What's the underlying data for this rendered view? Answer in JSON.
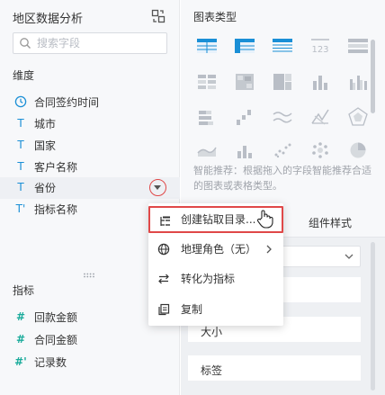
{
  "left_panel": {
    "title": "地区数据分析",
    "search_placeholder": "搜索字段",
    "dimension_title": "维度",
    "dimensions": [
      {
        "label": "合同签约时间",
        "icon": "clock-icon"
      },
      {
        "label": "城市",
        "icon": "text-type-icon",
        "glyph": "T"
      },
      {
        "label": "国家",
        "icon": "text-type-icon",
        "glyph": "T"
      },
      {
        "label": "客户名称",
        "icon": "text-type-icon",
        "glyph": "T"
      },
      {
        "label": "省份",
        "icon": "text-type-icon",
        "glyph": "T"
      },
      {
        "label": "指标名称",
        "icon": "text-type-calc-icon",
        "glyph": "T'"
      }
    ],
    "measure_title": "指标",
    "measures": [
      {
        "label": "回款金额",
        "icon": "number-type-icon",
        "glyph": "#"
      },
      {
        "label": "合同金额",
        "icon": "number-type-icon",
        "glyph": "#"
      },
      {
        "label": "记录数",
        "icon": "number-type-calc-icon",
        "glyph": "#'"
      }
    ]
  },
  "right_panel": {
    "chart_type_title": "图表类型",
    "chart_types": [
      "table-chart-icon",
      "crosstab-chart-icon",
      "detail-table-chart-icon",
      "kpi-chart-icon",
      "grouped-table-chart-icon",
      "color-table-chart-icon",
      "heatmap-chart-icon",
      "treemap-chart-icon",
      "bar-chart-icon",
      "grouped-bar-chart-icon",
      "stacked-bar-chart-icon",
      "waterfall-chart-icon",
      "line-chart-icon",
      "radar-chart-icon",
      "funnel-chart-icon",
      "area-chart-icon",
      "combo-chart-icon",
      "scatter-chart-icon",
      "bubble-chart-icon",
      "pie-chart-icon"
    ],
    "kpi_glyph": "123",
    "smart_tip": "智能推荐：根据拖入的字段智能推荐合适的图表或表格类型。",
    "component_style_tab": "组件样式",
    "properties": [
      "大小",
      "标签"
    ]
  },
  "context_menu": {
    "items": [
      {
        "label": "创建钻取目录...",
        "icon": "drill-tree-icon",
        "active": true
      },
      {
        "label": "地理角色（无）",
        "icon": "globe-icon",
        "has_submenu": true
      },
      {
        "label": "转化为指标",
        "icon": "swap-arrows-icon"
      },
      {
        "label": "复制",
        "icon": "copy-icon"
      }
    ]
  },
  "colors": {
    "accent_blue": "#1a8fd6",
    "accent_teal": "#1aab9b",
    "highlight_red": "#e04848",
    "chart_icon_gray": "#b9bec6"
  }
}
